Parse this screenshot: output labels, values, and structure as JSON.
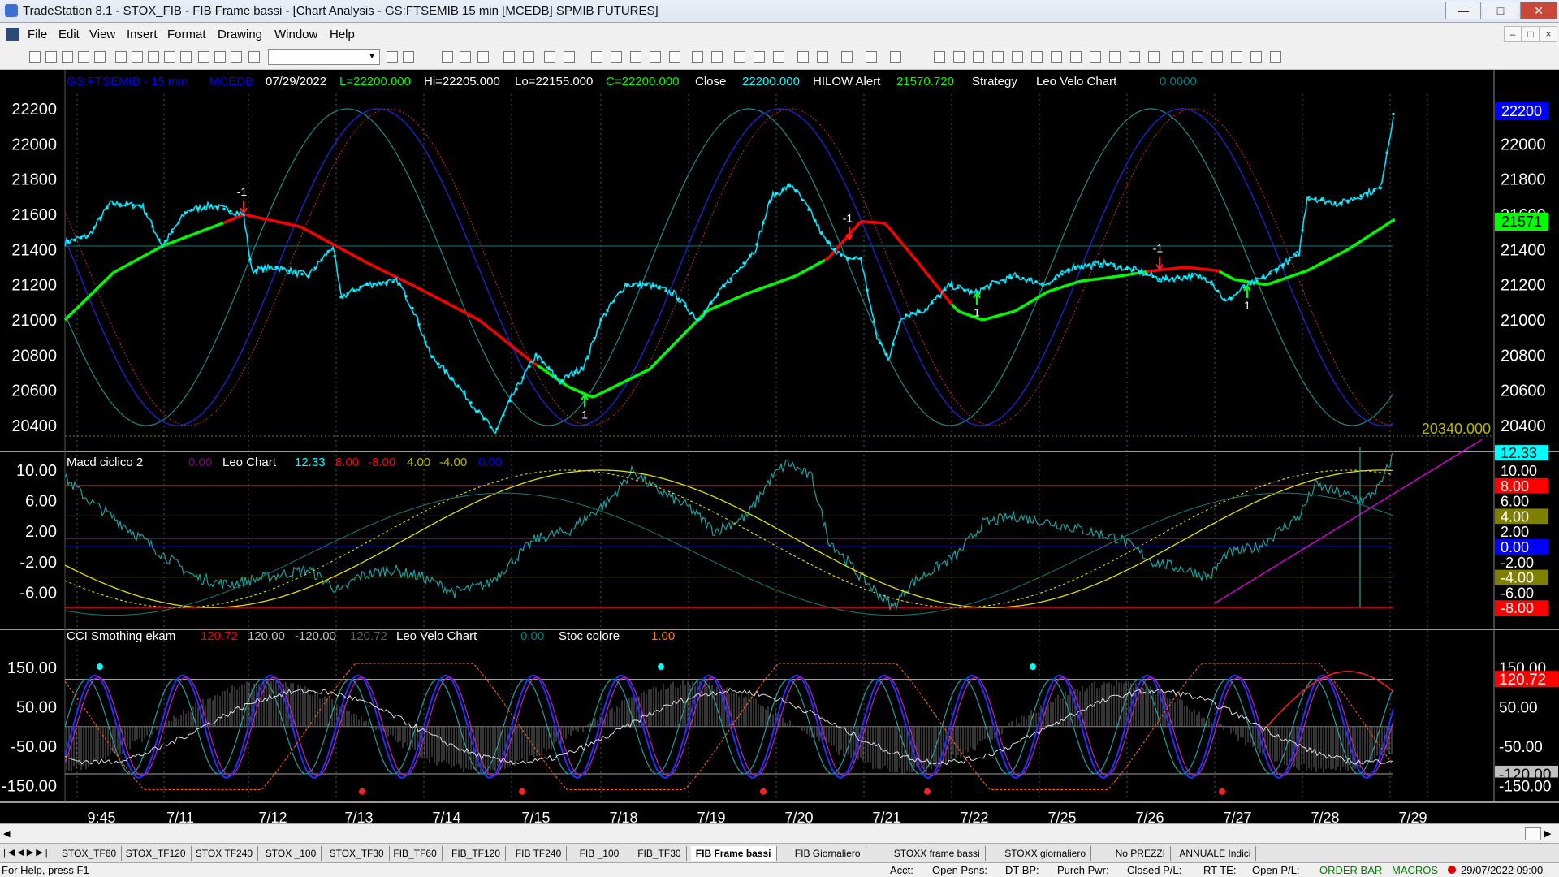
{
  "window": {
    "title": "TradeStation 8.1 - STOX_FIB - FIB Frame bassi - [Chart Analysis - GS:FTSEMIB  15 min  [MCEDB] SPMIB FUTURES]"
  },
  "menu": [
    "File",
    "Edit",
    "View",
    "Insert",
    "Format",
    "Drawing",
    "Window",
    "Help"
  ],
  "price_panel": {
    "header": {
      "symbol": "GS:FTSEMIB - 15 min",
      "source": "MCEDB",
      "date": "07/29/2022",
      "last": "L=22200.000",
      "hi": "Hi=22205.000",
      "lo": "Lo=22155.000",
      "close_eq": "C=22200.000",
      "close_label": "Close",
      "close_val": "22200.000",
      "hilow_label": "HILOW Alert",
      "hilow_val": "21570.720",
      "strategy": "Strategy",
      "leo_velo": "Leo Velo Chart",
      "leo_val": "0.0000"
    },
    "y_ticks": [
      "22200",
      "22000",
      "21800",
      "21600",
      "21400",
      "21200",
      "21000",
      "20800",
      "20600",
      "20400"
    ],
    "last_price_badge": "22200",
    "hilow_badge": "21571",
    "lowline_label": "20340.000",
    "signals": {
      "sell": "-1",
      "buy": "1"
    }
  },
  "macd_panel": {
    "header": {
      "name": "Macd ciclico 2",
      "v1": "0.00",
      "leo": "Leo Chart",
      "v2": "12.33",
      "v3": "8.00",
      "v4": "-8.00",
      "v5": "4.00",
      "v6": "-4.00",
      "v7": "0.00"
    },
    "y_ticks": [
      "10.00",
      "6.00",
      "2.00",
      "-2.00",
      "-6.00"
    ],
    "badges": [
      {
        "text": "12.33",
        "bg": "#00ffff",
        "fg": "#000000"
      },
      {
        "text": "10.00",
        "bg": "#000000",
        "fg": "#ffffff"
      },
      {
        "text": "8.00",
        "bg": "#ff0000",
        "fg": "#ffffff"
      },
      {
        "text": "6.00",
        "bg": "#000000",
        "fg": "#ffffff"
      },
      {
        "text": "4.00",
        "bg": "#808000",
        "fg": "#ffffff"
      },
      {
        "text": "2.00",
        "bg": "#000000",
        "fg": "#ffffff"
      },
      {
        "text": "0.00",
        "bg": "#0000ff",
        "fg": "#ffffff"
      },
      {
        "text": "-2.00",
        "bg": "#000000",
        "fg": "#ffffff"
      },
      {
        "text": "-4.00",
        "bg": "#808000",
        "fg": "#ffffff"
      },
      {
        "text": "-6.00",
        "bg": "#000000",
        "fg": "#ffffff"
      },
      {
        "text": "-8.00",
        "bg": "#ff0000",
        "fg": "#ffffff"
      }
    ]
  },
  "cci_panel": {
    "header": {
      "name": "CCI Smothing ekam",
      "v1": "120.72",
      "v2": "120.00",
      "v3": "-120.00",
      "v4": "120.72",
      "leo": "Leo Velo Chart",
      "v5": "0.00",
      "stoc": "Stoc colore",
      "v6": "1.00"
    },
    "y_ticks": [
      "150.00",
      "50.00",
      "-50.00",
      "-150.00"
    ],
    "badges": [
      {
        "text": "150.00",
        "bg": "#000000",
        "fg": "#ffffff"
      },
      {
        "text": "120.72",
        "bg": "#ff0000",
        "fg": "#ffffff"
      },
      {
        "text": "50.00",
        "bg": "#000000",
        "fg": "#ffffff"
      },
      {
        "text": "-50.00",
        "bg": "#000000",
        "fg": "#ffffff"
      },
      {
        "text": "-120.00",
        "bg": "#c0c0c0",
        "fg": "#000000"
      },
      {
        "text": "-150.00",
        "bg": "#000000",
        "fg": "#ffffff"
      }
    ]
  },
  "x_axis": [
    "9:45",
    "7/11",
    "7/12",
    "7/13",
    "7/14",
    "7/15",
    "7/18",
    "7/19",
    "7/20",
    "7/21",
    "7/22",
    "7/25",
    "7/26",
    "7/27",
    "7/28",
    "7/29"
  ],
  "tabs": [
    "STOX_TF60",
    "STOX_TF120",
    "STOX TF240",
    "STOX _100",
    "STOX_TF30",
    "FIB_TF60",
    "FIB_TF120",
    "FIB TF240",
    "FIB _100",
    "FIB_TF30",
    "FIB Frame bassi",
    "FIB Giornaliero",
    "STOXX frame bassi",
    "STOXX giornaliero",
    "No PREZZI",
    "ANNUALE Indici"
  ],
  "active_tab": "FIB Frame bassi",
  "status": {
    "help": "For Help, press F1",
    "acct": "Acct:",
    "open_psns": "Open Psns:",
    "dt_bp": "DT BP:",
    "purch_pwr": "Purch Pwr:",
    "closed_pl": "Closed P/L:",
    "rt_te": "RT TE:",
    "open_pl": "Open P/L:",
    "order_bar": "ORDER BAR",
    "macros": "MACROS",
    "datetime": "29/07/2022 09:00"
  }
}
